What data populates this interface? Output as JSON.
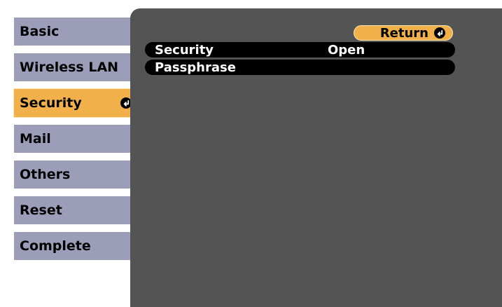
{
  "sidebar": {
    "items": [
      {
        "label": "Basic"
      },
      {
        "label": "Wireless LAN"
      },
      {
        "label": "Security"
      },
      {
        "label": "Mail"
      },
      {
        "label": "Others"
      },
      {
        "label": "Reset"
      },
      {
        "label": "Complete"
      }
    ],
    "selected": "Security"
  },
  "main": {
    "return_label": "Return",
    "rows": [
      {
        "label": "Security",
        "value": "Open"
      },
      {
        "label": "Passphrase",
        "value": ""
      }
    ]
  },
  "colors": {
    "panel": "#545454",
    "tab": "#9c9db8",
    "accent": "#f2b04b",
    "row": "#000000"
  },
  "icons": {
    "enter": "enter-icon"
  }
}
